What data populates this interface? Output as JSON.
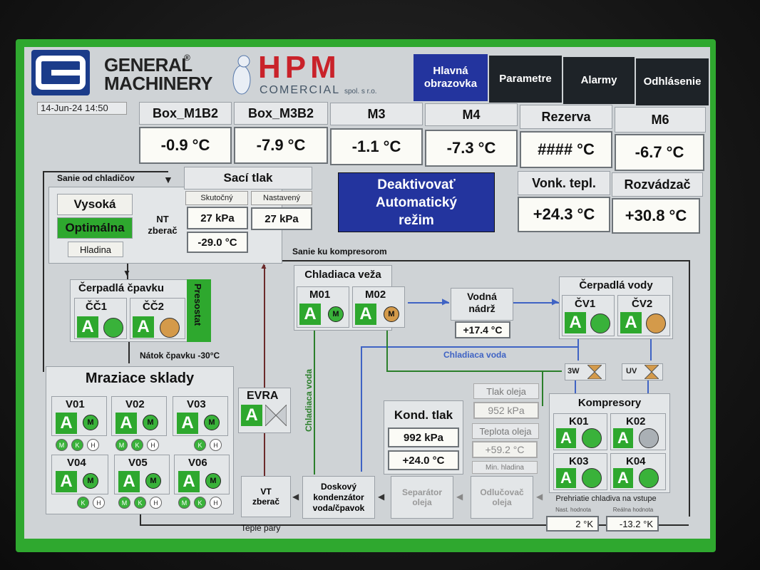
{
  "header": {
    "logo_line1": "GENERAL",
    "logo_line2": "MACHINERY",
    "logo_mark": "®",
    "hpm": "HPM",
    "hpm_sub": "COMERCIAL",
    "hpm_sub2": "spol. s r.o.",
    "datetime": "14-Jun-24 14:50"
  },
  "nav": [
    {
      "label": "Hlavná obrazovka",
      "active": true
    },
    {
      "label": "Parametre"
    },
    {
      "label": "Alarmy"
    },
    {
      "label": "Odhlásenie"
    }
  ],
  "temps": [
    {
      "name": "Box_M1B2",
      "value": "-0.9 °C"
    },
    {
      "name": "Box_M3B2",
      "value": "-7.9 °C"
    },
    {
      "name": "M3",
      "value": "-1.1 °C"
    },
    {
      "name": "M4",
      "value": "-7.3 °C"
    },
    {
      "name": "Rezerva",
      "value": "#### °C"
    },
    {
      "name": "M6",
      "value": "-6.7 °C"
    }
  ],
  "outdoor": {
    "name": "Vonk. tepl.",
    "value": "+24.3 °C"
  },
  "cabinet": {
    "name": "Rozvádzač",
    "value": "+30.8 °C"
  },
  "auto_button": "Deaktivovať Automatický režim",
  "suction": {
    "title": "Sací tlak",
    "col_actual": "Skutočný",
    "col_set": "Nastavený",
    "actual": "27 kPa",
    "set": "27 kPa",
    "temp": "-29.0 °C"
  },
  "level": {
    "high": "Vysoká",
    "optimal": "Optimálna",
    "label": "Hladina",
    "nt_label": "NT zberač"
  },
  "flow_labels": {
    "from_coolers": "Sanie od chladičov",
    "to_compressors": "Sanie ku kompresorom",
    "nh3_inflow": "Nátok čpavku -30°C",
    "cooling_water": "Chladiaca voda",
    "cooling_water_v": "Chladiaca voda",
    "hot_vapors": "Teplé pary"
  },
  "pumps_nh3": {
    "title": "Čerpadlá čpavku",
    "pressostat": "Presostat",
    "units": [
      {
        "name": "ČČ1",
        "mode": "A",
        "state": "green"
      },
      {
        "name": "ČČ2",
        "mode": "A",
        "state": "orange"
      }
    ]
  },
  "tower": {
    "title": "Chladiaca veža",
    "units": [
      {
        "name": "M01",
        "mode": "A",
        "motor": "M",
        "state": "green"
      },
      {
        "name": "M02",
        "mode": "A",
        "motor": "M",
        "state": "orange"
      }
    ]
  },
  "water_tank": {
    "title": "Vodná nádrž",
    "value": "+17.4 °C"
  },
  "water_pumps": {
    "title": "Čerpadlá vody",
    "units": [
      {
        "name": "ČV1",
        "mode": "A",
        "state": "green"
      },
      {
        "name": "ČV2",
        "mode": "A",
        "state": "orange"
      }
    ]
  },
  "valves": {
    "v3w": "3W",
    "uv": "UV"
  },
  "freezers": {
    "title": "Mraziace sklady",
    "units": [
      {
        "name": "V01",
        "mode": "A",
        "motor": "M",
        "aux": [
          "M",
          "K",
          "H"
        ]
      },
      {
        "name": "V02",
        "mode": "A",
        "motor": "M",
        "aux": [
          "M",
          "K",
          "H"
        ]
      },
      {
        "name": "V03",
        "mode": "A",
        "motor": "M",
        "aux": [
          "K",
          "H"
        ]
      },
      {
        "name": "V04",
        "mode": "A",
        "motor": "M",
        "aux": [
          "K",
          "H"
        ]
      },
      {
        "name": "V05",
        "mode": "A",
        "motor": "M",
        "aux": [
          "M",
          "K",
          "H"
        ]
      },
      {
        "name": "V06",
        "mode": "A",
        "motor": "M",
        "aux": [
          "M",
          "K",
          "H"
        ]
      }
    ]
  },
  "evra": {
    "title": "EVRA",
    "mode": "A"
  },
  "condenser_pressure": {
    "title": "Kond. tlak",
    "pressure": "992 kPa",
    "temp": "+24.0 °C"
  },
  "oil": {
    "pressure_label": "Tlak oleja",
    "pressure": "952 kPa",
    "temp_label": "Teplota oleja",
    "temp": "+59.2 °C",
    "min_level": "Min. hladina"
  },
  "compressors": {
    "title": "Kompresory",
    "units": [
      {
        "name": "K01",
        "mode": "A",
        "state": "green"
      },
      {
        "name": "K02",
        "mode": "A",
        "state": "gray"
      },
      {
        "name": "K03",
        "mode": "A",
        "state": "green"
      },
      {
        "name": "K04",
        "mode": "A",
        "state": "green"
      }
    ],
    "superheat_title": "Prehriatie chladiva na vstupe",
    "set_label": "Nast. hodnota",
    "real_label": "Reálna hodnota",
    "set_value": "2 °K",
    "real_value": "-13.2 °K"
  },
  "bottom_boxes": {
    "vt": "VT zberač",
    "condenser": "Doskový kondenzátor voda/čpavok",
    "separator": "Separátor oleja",
    "separator2": "Odlučovač oleja"
  }
}
